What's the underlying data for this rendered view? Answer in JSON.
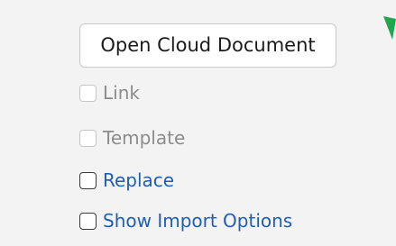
{
  "open_cloud_button": {
    "label": "Open Cloud Document"
  },
  "options": [
    {
      "label": "Link",
      "checked": false,
      "enabled": false
    },
    {
      "label": "Template",
      "checked": false,
      "enabled": false
    },
    {
      "label": "Replace",
      "checked": false,
      "enabled": true
    },
    {
      "label": "Show Import Options",
      "checked": false,
      "enabled": true
    }
  ],
  "colors": {
    "background": "#f3f3f3",
    "enabled_label": "#1f5faf",
    "disabled_label": "#8c8c8c",
    "arrow": "#1ea84b"
  }
}
